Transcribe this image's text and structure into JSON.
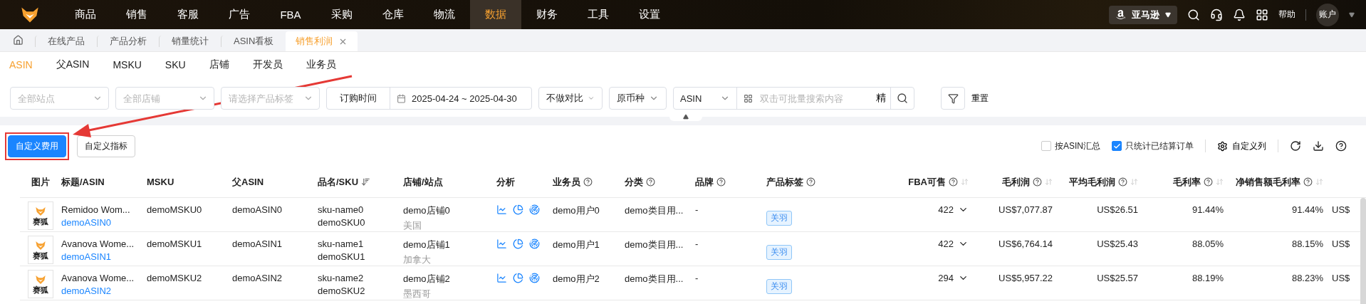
{
  "nav": {
    "items": [
      {
        "label": "商品",
        "selected": false
      },
      {
        "label": "销售",
        "selected": false
      },
      {
        "label": "客服",
        "selected": false
      },
      {
        "label": "广告",
        "selected": false
      },
      {
        "label": "FBA",
        "selected": false
      },
      {
        "label": "采购",
        "selected": false
      },
      {
        "label": "仓库",
        "selected": false
      },
      {
        "label": "物流",
        "selected": false
      },
      {
        "label": "数据",
        "selected": true
      },
      {
        "label": "财务",
        "selected": false
      },
      {
        "label": "工具",
        "selected": false
      },
      {
        "label": "设置",
        "selected": false
      }
    ],
    "platform": "亚马逊",
    "help": "帮助",
    "account": "账户"
  },
  "page_tabs": [
    {
      "label": "在线产品",
      "selected": false,
      "closable": false
    },
    {
      "label": "产品分析",
      "selected": false,
      "closable": false
    },
    {
      "label": "销量统计",
      "selected": false,
      "closable": false
    },
    {
      "label": "ASIN看板",
      "selected": false,
      "closable": false
    },
    {
      "label": "销售利润",
      "selected": true,
      "closable": true
    }
  ],
  "view_tabs": [
    {
      "label": "ASIN",
      "selected": true
    },
    {
      "label": "父ASIN",
      "selected": false
    },
    {
      "label": "MSKU",
      "selected": false
    },
    {
      "label": "SKU",
      "selected": false
    },
    {
      "label": "店铺",
      "selected": false
    },
    {
      "label": "开发员",
      "selected": false
    },
    {
      "label": "业务员",
      "selected": false
    }
  ],
  "filters": {
    "site": {
      "placeholder": "全部站点"
    },
    "shop": {
      "placeholder": "全部店铺"
    },
    "tag": {
      "placeholder": "请选择产品标签"
    },
    "date_type": "订购时间",
    "date_range": "2025-04-24 ~ 2025-04-30",
    "compare": "不做对比",
    "currency": "原币种",
    "search_field": "ASIN",
    "search": {
      "placeholder": "双击可批量搜索内容"
    },
    "exact": "精",
    "reset": "重置"
  },
  "actions": {
    "buttons": [
      {
        "label": "自定义费用",
        "kind": "primary",
        "highlighted": true
      },
      {
        "label": "自定义指标",
        "kind": "default",
        "highlighted": false
      }
    ],
    "options": [
      {
        "label": "按ASIN汇总",
        "checked": false
      },
      {
        "label": "只统计已结算订单",
        "checked": true
      }
    ],
    "columns_button": "自定义列"
  },
  "table": {
    "columns": [
      {
        "kind": "image",
        "label": "图片"
      },
      {
        "kind": "link",
        "label": "标题/ASIN"
      },
      {
        "kind": "text",
        "label": "MSKU"
      },
      {
        "kind": "text",
        "label": "父ASIN"
      },
      {
        "kind": "pair",
        "label": "品名/SKU",
        "sort": true
      },
      {
        "kind": "pair",
        "label": "店铺/站点"
      },
      {
        "kind": "icons",
        "label": "分析"
      },
      {
        "kind": "text",
        "label": "业务员",
        "help": true
      },
      {
        "kind": "text",
        "label": "分类",
        "help": true
      },
      {
        "kind": "text",
        "label": "品牌",
        "help": true
      },
      {
        "kind": "tag",
        "label": "产品标签",
        "help": true
      },
      {
        "kind": "stock",
        "label": "FBA可售",
        "help": true,
        "sort": true
      },
      {
        "kind": "number",
        "label": "毛利润",
        "help": true,
        "sort": true
      },
      {
        "kind": "number",
        "label": "平均毛利润",
        "help": true,
        "sort": true
      },
      {
        "kind": "number",
        "label": "毛利率",
        "help": true,
        "sort": true
      },
      {
        "kind": "number",
        "label": "净销售额毛利率",
        "help": true,
        "sort": true
      },
      {
        "kind": "text"
      }
    ],
    "rows": [
      {
        "cells": [
          [
            "赛狐"
          ],
          [
            "Remidoo Wom...",
            "demoASIN0"
          ],
          [
            "demoMSKU0"
          ],
          [
            "demoASIN0"
          ],
          [
            "sku-name0",
            "demoSKU0"
          ],
          [
            "demo店铺0",
            "美国"
          ],
          [],
          [
            "demo用户0"
          ],
          [
            "demo类目用..."
          ],
          [
            "-"
          ],
          [
            "关羽"
          ],
          [
            "422"
          ],
          [
            "US$7,077.87"
          ],
          [
            "US$26.51"
          ],
          [
            "91.44%"
          ],
          [
            "91.44%"
          ],
          [
            "US$"
          ]
        ]
      },
      {
        "cells": [
          [
            "赛狐"
          ],
          [
            "Avanova Wome...",
            "demoASIN1"
          ],
          [
            "demoMSKU1"
          ],
          [
            "demoASIN1"
          ],
          [
            "sku-name1",
            "demoSKU1"
          ],
          [
            "demo店铺1",
            "加拿大"
          ],
          [],
          [
            "demo用户1"
          ],
          [
            "demo类目用..."
          ],
          [
            "-"
          ],
          [
            "关羽"
          ],
          [
            "422"
          ],
          [
            "US$6,764.14"
          ],
          [
            "US$25.43"
          ],
          [
            "88.05%"
          ],
          [
            "88.15%"
          ],
          [
            "US$"
          ]
        ]
      },
      {
        "cells": [
          [
            "赛狐"
          ],
          [
            "Avanova Wome...",
            "demoASIN2"
          ],
          [
            "demoMSKU2"
          ],
          [
            "demoASIN2"
          ],
          [
            "sku-name2",
            "demoSKU2"
          ],
          [
            "demo店铺2",
            "墨西哥"
          ],
          [],
          [
            "demo用户2"
          ],
          [
            "demo类目用..."
          ],
          [
            "-"
          ],
          [
            "关羽"
          ],
          [
            "294"
          ],
          [
            "US$5,957.22"
          ],
          [
            "US$25.57"
          ],
          [
            "88.19%"
          ],
          [
            "88.23%"
          ],
          [
            "US$"
          ]
        ]
      }
    ]
  }
}
